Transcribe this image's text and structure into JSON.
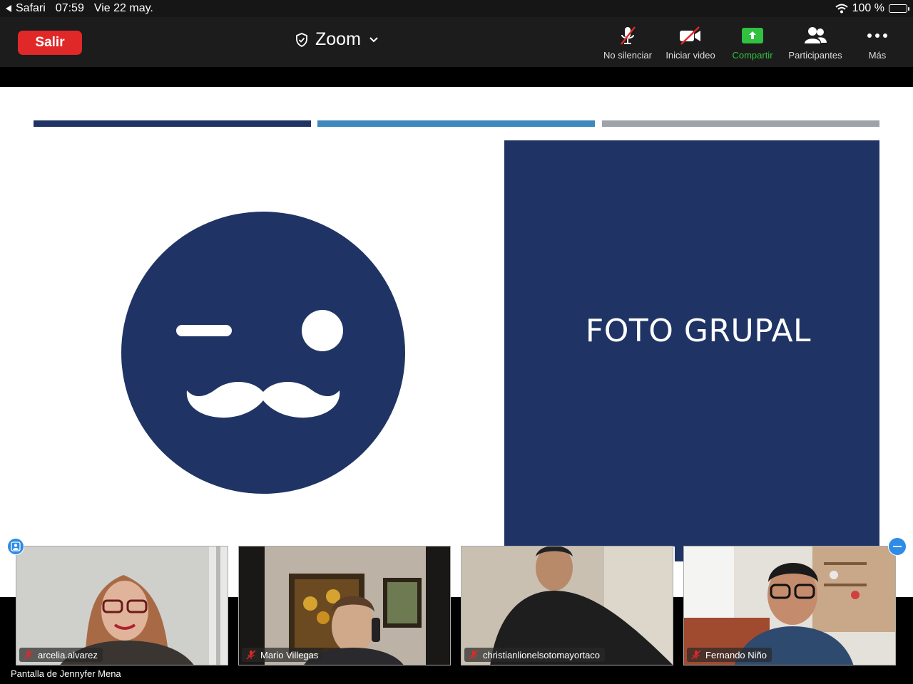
{
  "status_bar": {
    "back_app": "Safari",
    "time": "07:59",
    "date": "Vie 22 may.",
    "battery": "100 %"
  },
  "toolbar": {
    "leave_label": "Salir",
    "meeting_title": "Zoom",
    "items": [
      {
        "label": "No silenciar",
        "icon": "mic-muted-icon"
      },
      {
        "label": "Iniciar video",
        "icon": "video-off-icon"
      },
      {
        "label": "Compartir",
        "icon": "share-screen-icon"
      },
      {
        "label": "Participantes",
        "icon": "participants-icon"
      },
      {
        "label": "Más",
        "icon": "more-icon"
      }
    ]
  },
  "slide": {
    "title": "FOTO GRUPAL",
    "colors": {
      "navy": "#1f3464",
      "blue": "#3e88bd",
      "gray": "#9ea3aa"
    }
  },
  "participants": [
    {
      "name": "arcelia.alvarez",
      "muted": true
    },
    {
      "name": "Mario Villegas",
      "muted": true
    },
    {
      "name": "christianlionelsotomayortaco",
      "muted": true
    },
    {
      "name": "Fernando Niño",
      "muted": true
    }
  ],
  "screen_owner": "Pantalla de Jennyfer Mena",
  "colors": {
    "leave": "#e02828",
    "share_green": "#31c03f",
    "accent_blue": "#2e8ce6"
  }
}
